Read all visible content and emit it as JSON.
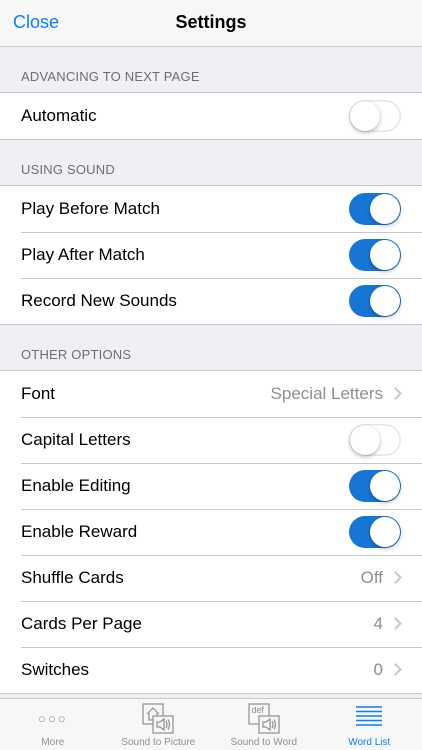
{
  "nav": {
    "close_label": "Close",
    "title": "Settings"
  },
  "sections": [
    {
      "header": "ADVANCING TO NEXT PAGE",
      "rows": [
        {
          "label": "Automatic",
          "type": "toggle",
          "on": false
        }
      ]
    },
    {
      "header": "USING SOUND",
      "rows": [
        {
          "label": "Play Before Match",
          "type": "toggle",
          "on": true
        },
        {
          "label": "Play After Match",
          "type": "toggle",
          "on": true
        },
        {
          "label": "Record New Sounds",
          "type": "toggle",
          "on": true
        }
      ]
    },
    {
      "header": "OTHER OPTIONS",
      "rows": [
        {
          "label": "Font",
          "type": "value",
          "value": "Special Letters"
        },
        {
          "label": "Capital Letters",
          "type": "toggle",
          "on": false
        },
        {
          "label": "Enable Editing",
          "type": "toggle",
          "on": true
        },
        {
          "label": "Enable Reward",
          "type": "toggle",
          "on": true
        },
        {
          "label": "Shuffle Cards",
          "type": "value",
          "value": "Off"
        },
        {
          "label": "Cards Per Page",
          "type": "value",
          "value": "4"
        },
        {
          "label": "Switches",
          "type": "value",
          "value": "0"
        }
      ]
    }
  ],
  "tabbar": {
    "tabs": [
      {
        "label": "More",
        "icon": "more-dots-icon",
        "glyph": "○○○",
        "active": false
      },
      {
        "label": "Sound to Picture",
        "icon": "sound-to-picture-icon",
        "active": false
      },
      {
        "label": "Sound to Word",
        "icon": "sound-to-word-icon",
        "icon_text": "def",
        "active": false
      },
      {
        "label": "Word List",
        "icon": "word-list-icon",
        "active": true
      }
    ]
  },
  "colors": {
    "accent": "#0a7cff",
    "toggle_on": "#1775d5",
    "background": "#efeff4",
    "separator": "#c8c7cc",
    "secondary_text": "#8e8e93"
  }
}
